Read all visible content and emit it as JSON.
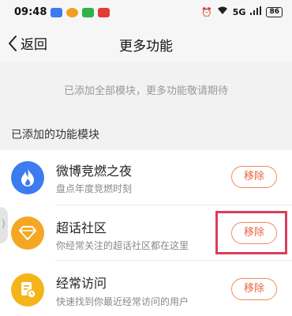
{
  "status_bar": {
    "time": "09:48",
    "network": "5G",
    "battery": "86"
  },
  "nav": {
    "back_label": "返回",
    "title": "更多功能"
  },
  "notice": "已添加全部模块，更多功能敬请期待",
  "section_title": "已添加的功能模块",
  "items": [
    {
      "title": "微博竞燃之夜",
      "desc": "盘点年度竞燃时刻",
      "button": "移除",
      "icon": "flame-icon",
      "color": "#3c7bf0"
    },
    {
      "title": "超话社区",
      "desc": "你经常关注的超话社区都在这里",
      "button": "移除",
      "icon": "diamond-icon",
      "color": "#f5a623"
    },
    {
      "title": "经常访问",
      "desc": "快速找到你最近经常访问的用户",
      "button": "移除",
      "icon": "document-clock-icon",
      "color": "#f5b41a"
    }
  ],
  "colors": {
    "accent": "#e8643a",
    "highlight": "#d93d5a"
  }
}
